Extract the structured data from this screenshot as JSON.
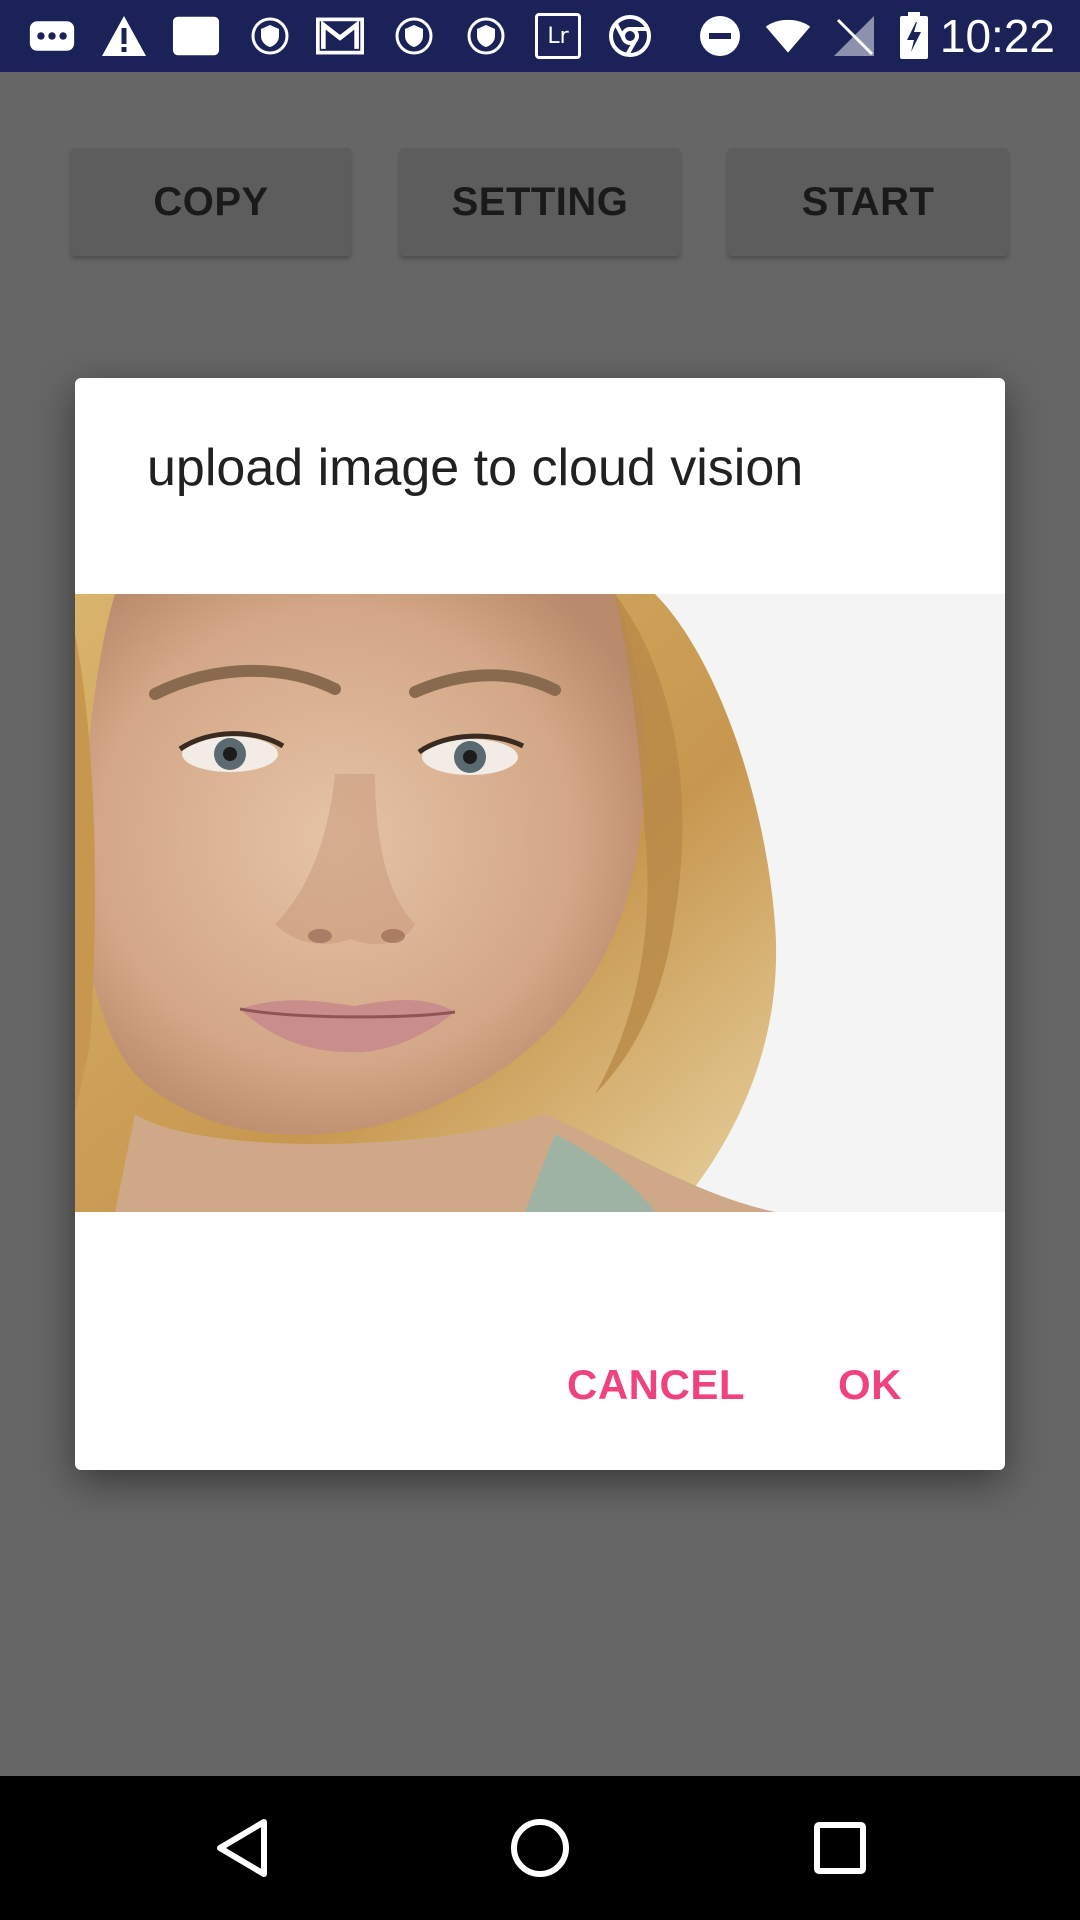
{
  "status_bar": {
    "time": "10:22",
    "icons": [
      "chat-icon",
      "warning-icon",
      "image-icon",
      "shield-icon",
      "gmail-icon",
      "shield-icon",
      "shield-icon",
      "lightroom-icon",
      "chrome-icon",
      "do-not-disturb-icon",
      "wifi-icon",
      "no-signal-icon",
      "battery-charging-icon"
    ],
    "lightroom_label": "Lr"
  },
  "app": {
    "buttons": [
      {
        "label": "COPY"
      },
      {
        "label": "SETTING"
      },
      {
        "label": "START"
      }
    ]
  },
  "dialog": {
    "title": "upload image to cloud vision",
    "cancel_label": "CANCEL",
    "ok_label": "OK",
    "accent_color": "#f0437c"
  },
  "nav_bar": {
    "icons": [
      "back-icon",
      "home-icon",
      "recents-icon"
    ]
  }
}
